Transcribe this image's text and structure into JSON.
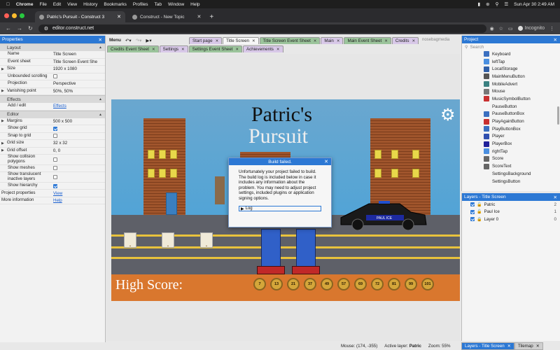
{
  "mac_menubar": {
    "app": "Chrome",
    "menus": [
      "File",
      "Edit",
      "View",
      "History",
      "Bookmarks",
      "Profiles",
      "Tab",
      "Window",
      "Help"
    ],
    "datetime": "Sun Apr 30  2:49 AM"
  },
  "browser": {
    "tabs": [
      {
        "title": "Patric's Pursuit - Construct 3",
        "active": true
      },
      {
        "title": "Construct - New Topic",
        "active": false
      }
    ],
    "url": "editor.construct.net",
    "profile": "Incognito"
  },
  "properties": {
    "header": "Properties",
    "sections": [
      {
        "title": "Layout",
        "rows": [
          {
            "key": "Name",
            "value": "Title Screen"
          },
          {
            "key": "Event sheet",
            "value": "Title Screen Event She"
          },
          {
            "key": "Size",
            "value": "1920 x 1080",
            "expandable": true
          },
          {
            "key": "Unbounded scrolling",
            "checkbox": false
          },
          {
            "key": "Projection",
            "value": "Perspective"
          },
          {
            "key": "Vanishing point",
            "value": "50%, 50%",
            "expandable": true
          }
        ]
      },
      {
        "title": "Effects",
        "rows": [
          {
            "key": "Add / edit",
            "link": "Effects"
          }
        ]
      },
      {
        "title": "Editor",
        "rows": [
          {
            "key": "Margins",
            "value": "500 x 500",
            "expandable": true
          },
          {
            "key": "Show grid",
            "checkbox": true
          },
          {
            "key": "Snap to grid",
            "checkbox": false
          },
          {
            "key": "Grid size",
            "value": "32 x 32",
            "expandable": true
          },
          {
            "key": "Grid offset",
            "value": "0, 0",
            "expandable": true
          },
          {
            "key": "Show collision polygons",
            "checkbox": false
          },
          {
            "key": "Show meshes",
            "checkbox": false
          },
          {
            "key": "Show translucent inactive layers",
            "checkbox": false
          },
          {
            "key": "Show hierarchy",
            "checkbox": true
          }
        ]
      }
    ],
    "footer": [
      {
        "key": "Project properties",
        "link": "View"
      },
      {
        "key": "More information",
        "link": "Help"
      }
    ]
  },
  "toolbar": {
    "menu_label": "Menu"
  },
  "editor_tabs_row1": [
    {
      "label": "Start page",
      "kind": "normal",
      "active": false
    },
    {
      "label": "Title Screen",
      "kind": "layout",
      "active": true
    },
    {
      "label": "Title Screen Event Sheet",
      "kind": "event",
      "active": false
    },
    {
      "label": "Main",
      "kind": "normal",
      "active": false
    },
    {
      "label": "Main Event Sheet",
      "kind": "event",
      "active": false
    },
    {
      "label": "Credits",
      "kind": "normal",
      "active": false
    }
  ],
  "editor_tabs_row2": [
    {
      "label": "Credits Event Sheet",
      "kind": "event"
    },
    {
      "label": "Settings",
      "kind": "normal"
    },
    {
      "label": "Settings Event Sheet",
      "kind": "event"
    },
    {
      "label": "Achievements",
      "kind": "normal"
    }
  ],
  "brand": "nosebagmedia",
  "game": {
    "title_line1": "Patric's",
    "title_line2": "Pursuit",
    "high_score_label": "High Score:",
    "coins": [
      "7",
      "13",
      "21",
      "37",
      "49",
      "57",
      "69",
      "72",
      "81",
      "99",
      "101"
    ],
    "car_text": "PAUL ICE"
  },
  "dialog": {
    "title": "Build failed.",
    "message": "Unfortunately your project failed to build. The build log is included below in case it includes any information about the problem. You may need to adjust project settings, included plugins or application signing options.",
    "log_label": "Log"
  },
  "project": {
    "header": "Project",
    "search_placeholder": "Search",
    "items": [
      {
        "label": "Keyboard",
        "color": "#3a6fc0"
      },
      {
        "label": "leftTap",
        "color": "#4a8fe0"
      },
      {
        "label": "LocalStorage",
        "color": "#2f5fa8"
      },
      {
        "label": "MainMenuButton",
        "color": "#555555"
      },
      {
        "label": "MobileAdvert",
        "color": "#3a8080"
      },
      {
        "label": "Mouse",
        "color": "#777777"
      },
      {
        "label": "MusicSymbolButton",
        "color": "#c83030"
      },
      {
        "label": "PauseButton",
        "color": "#f4f4f4"
      },
      {
        "label": "PauseButtonBox",
        "color": "#3a6fc0"
      },
      {
        "label": "PlayAgainButton",
        "color": "#c83030"
      },
      {
        "label": "PlayButtonBox",
        "color": "#3a6fc0"
      },
      {
        "label": "Player",
        "color": "#3050b0"
      },
      {
        "label": "PlayerBox",
        "color": "#20209a"
      },
      {
        "label": "rightTap",
        "color": "#4a8fe0"
      },
      {
        "label": "Score",
        "color": "#666666"
      },
      {
        "label": "ScoreText",
        "color": "#666666"
      },
      {
        "label": "SettingsBackground",
        "color": "#f4f4f4"
      },
      {
        "label": "SettingsButton",
        "color": "#f4f4f4"
      }
    ]
  },
  "layers": {
    "header": "Layers - Title Screen",
    "items": [
      {
        "label": "Patric",
        "num": "2",
        "locked": false
      },
      {
        "label": "Paul Ice",
        "num": "1",
        "locked": false
      },
      {
        "label": "Layer 0",
        "num": "0",
        "locked": true
      }
    ]
  },
  "status": {
    "mouse": "Mouse: (174, -355)",
    "active_layer_label": "Active layer:",
    "active_layer": "Patric",
    "zoom": "Zoom: 55%"
  },
  "bottom_tabs": [
    {
      "label": "Layers - Title Screen",
      "active": true
    },
    {
      "label": "Tilemap",
      "active": false
    }
  ]
}
